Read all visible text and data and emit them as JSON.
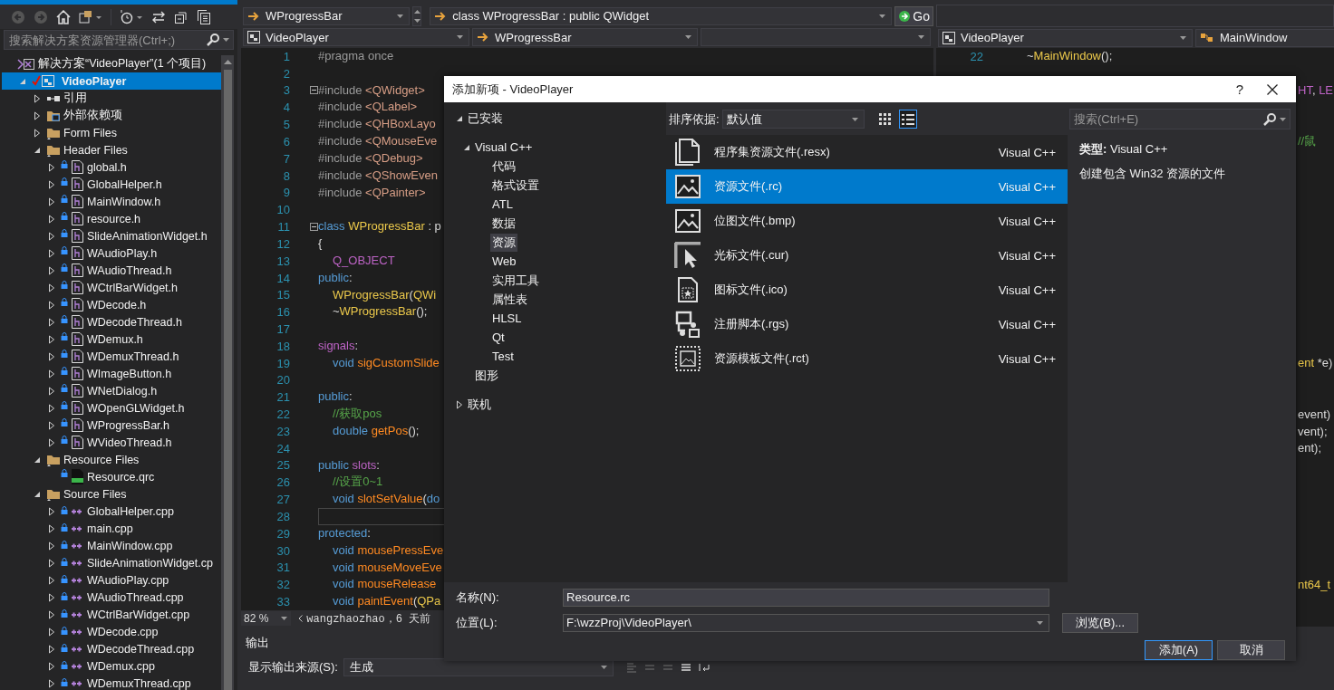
{
  "solution_explorer": {
    "search": {
      "placeholder": "搜索解决方案资源管理器(Ctrl+;)"
    },
    "tree": [
      {
        "label": "解决方案“VideoPlayer”(1 个项目)",
        "kind": "solution",
        "selected": false,
        "children": [
          {
            "label": "VideoPlayer",
            "kind": "project",
            "selected": true,
            "expanded": true,
            "children": [
              {
                "label": "引用",
                "kind": "references",
                "selected": false,
                "expanded": false
              },
              {
                "label": "外部依赖项",
                "kind": "dependencies",
                "selected": false,
                "expanded": false
              },
              {
                "label": "Form Files",
                "kind": "filter",
                "selected": false,
                "expanded": false
              },
              {
                "label": "Header Files",
                "kind": "filter",
                "selected": false,
                "expanded": true,
                "children": [
                  {
                    "label": "global.h",
                    "kind": "header",
                    "selected": false,
                    "expanded": false
                  },
                  {
                    "label": "GlobalHelper.h",
                    "kind": "header",
                    "selected": false,
                    "expanded": false
                  },
                  {
                    "label": "MainWindow.h",
                    "kind": "header",
                    "selected": false,
                    "expanded": false
                  },
                  {
                    "label": "resource.h",
                    "kind": "header",
                    "selected": false,
                    "expanded": false
                  },
                  {
                    "label": "SlideAnimationWidget.h",
                    "kind": "header",
                    "selected": false,
                    "expanded": false
                  },
                  {
                    "label": "WAudioPlay.h",
                    "kind": "header",
                    "selected": false,
                    "expanded": false
                  },
                  {
                    "label": "WAudioThread.h",
                    "kind": "header",
                    "selected": false,
                    "expanded": false
                  },
                  {
                    "label": "WCtrlBarWidget.h",
                    "kind": "header",
                    "selected": false,
                    "expanded": false
                  },
                  {
                    "label": "WDecode.h",
                    "kind": "header",
                    "selected": false,
                    "expanded": false
                  },
                  {
                    "label": "WDecodeThread.h",
                    "kind": "header",
                    "selected": false,
                    "expanded": false
                  },
                  {
                    "label": "WDemux.h",
                    "kind": "header",
                    "selected": false,
                    "expanded": false
                  },
                  {
                    "label": "WDemuxThread.h",
                    "kind": "header",
                    "selected": false,
                    "expanded": false
                  },
                  {
                    "label": "WImageButton.h",
                    "kind": "header",
                    "selected": false,
                    "expanded": false
                  },
                  {
                    "label": "WNetDialog.h",
                    "kind": "header",
                    "selected": false,
                    "expanded": false
                  },
                  {
                    "label": "WOpenGLWidget.h",
                    "kind": "header",
                    "selected": false,
                    "expanded": false
                  },
                  {
                    "label": "WProgressBar.h",
                    "kind": "header",
                    "selected": false,
                    "expanded": false
                  },
                  {
                    "label": "WVideoThread.h",
                    "kind": "header",
                    "selected": false,
                    "expanded": false
                  }
                ]
              },
              {
                "label": "Resource Files",
                "kind": "filter",
                "selected": false,
                "expanded": true,
                "children": [
                  {
                    "label": "Resource.qrc",
                    "kind": "qrc",
                    "selected": false
                  }
                ]
              },
              {
                "label": "Source Files",
                "kind": "filter",
                "selected": false,
                "expanded": true,
                "children": [
                  {
                    "label": "GlobalHelper.cpp",
                    "kind": "source",
                    "selected": false,
                    "expanded": false
                  },
                  {
                    "label": "main.cpp",
                    "kind": "source",
                    "selected": false,
                    "expanded": false
                  },
                  {
                    "label": "MainWindow.cpp",
                    "kind": "source",
                    "selected": false,
                    "expanded": false
                  },
                  {
                    "label": "SlideAnimationWidget.cp",
                    "kind": "source",
                    "selected": false,
                    "expanded": false
                  },
                  {
                    "label": "WAudioPlay.cpp",
                    "kind": "source",
                    "selected": false,
                    "expanded": false
                  },
                  {
                    "label": "WAudioThread.cpp",
                    "kind": "source",
                    "selected": false,
                    "expanded": false
                  },
                  {
                    "label": "WCtrlBarWidget.cpp",
                    "kind": "source",
                    "selected": false,
                    "expanded": false
                  },
                  {
                    "label": "WDecode.cpp",
                    "kind": "source",
                    "selected": false,
                    "expanded": false
                  },
                  {
                    "label": "WDecodeThread.cpp",
                    "kind": "source",
                    "selected": false,
                    "expanded": false
                  },
                  {
                    "label": "WDemux.cpp",
                    "kind": "source",
                    "selected": false,
                    "expanded": false
                  },
                  {
                    "label": "WDemuxThread.cpp",
                    "kind": "source",
                    "selected": false,
                    "expanded": false
                  }
                ]
              }
            ]
          }
        ]
      }
    ]
  },
  "editor": {
    "nav": {
      "scope": "WProgressBar",
      "member": "class WProgressBar : public QWidget",
      "go": "Go",
      "project": "VideoPlayer",
      "class": "WProgressBar"
    },
    "lines": [
      {
        "n": "1",
        "parts": [
          {
            "kind": "directive",
            "text": "#pragma once"
          }
        ]
      },
      {
        "n": "2"
      },
      {
        "n": "3",
        "fold": true,
        "parts": [
          {
            "kind": "directive",
            "text": "#include "
          },
          {
            "kind": "header",
            "text": "<QWidget>"
          }
        ]
      },
      {
        "n": "4",
        "parts": [
          {
            "kind": "directive",
            "text": "#include "
          },
          {
            "kind": "header",
            "text": "<QLabel>"
          }
        ]
      },
      {
        "n": "5",
        "parts": [
          {
            "kind": "directive",
            "text": "#include "
          },
          {
            "kind": "header",
            "text": "<QHBoxLayo"
          }
        ]
      },
      {
        "n": "6",
        "parts": [
          {
            "kind": "directive",
            "text": "#include "
          },
          {
            "kind": "header",
            "text": "<QMouseEve"
          }
        ]
      },
      {
        "n": "7",
        "parts": [
          {
            "kind": "directive",
            "text": "#include "
          },
          {
            "kind": "header",
            "text": "<QDebug>"
          }
        ]
      },
      {
        "n": "8",
        "parts": [
          {
            "kind": "directive",
            "text": "#include "
          },
          {
            "kind": "header",
            "text": "<QShowEven"
          }
        ]
      },
      {
        "n": "9",
        "parts": [
          {
            "kind": "directive",
            "text": "#include "
          },
          {
            "kind": "header",
            "text": "<QPainter>"
          }
        ]
      },
      {
        "n": "10"
      },
      {
        "n": "11",
        "fold": true,
        "parts": [
          {
            "kind": "keyword",
            "text": "class "
          },
          {
            "kind": "type",
            "text": "WProgressBar"
          },
          {
            "kind": "plain",
            "text": " : p"
          }
        ]
      },
      {
        "n": "12",
        "parts": [
          {
            "kind": "plain",
            "text": "{"
          }
        ]
      },
      {
        "n": "13",
        "indented": true,
        "parts": [
          {
            "kind": "macro",
            "text": "Q_OBJECT"
          }
        ]
      },
      {
        "n": "14",
        "parts": [
          {
            "kind": "keyword",
            "text": "public"
          },
          {
            "kind": "plain",
            "text": ":"
          }
        ]
      },
      {
        "n": "15",
        "indented": true,
        "parts": [
          {
            "kind": "type",
            "text": "WProgressBar"
          },
          {
            "kind": "plain",
            "text": "("
          },
          {
            "kind": "type",
            "text": "QWi"
          }
        ]
      },
      {
        "n": "16",
        "indented": true,
        "parts": [
          {
            "kind": "plain",
            "text": "~"
          },
          {
            "kind": "type",
            "text": "WProgressBar"
          },
          {
            "kind": "plain",
            "text": "();"
          }
        ]
      },
      {
        "n": "17"
      },
      {
        "n": "18",
        "parts": [
          {
            "kind": "macro",
            "text": "signals"
          },
          {
            "kind": "plain",
            "text": ":"
          }
        ]
      },
      {
        "n": "19",
        "indented": true,
        "parts": [
          {
            "kind": "keyword",
            "text": "void "
          },
          {
            "kind": "func",
            "text": "sigCustomSlide"
          }
        ]
      },
      {
        "n": "20"
      },
      {
        "n": "21",
        "parts": [
          {
            "kind": "keyword",
            "text": "public"
          },
          {
            "kind": "plain",
            "text": ":"
          }
        ]
      },
      {
        "n": "22",
        "indented": true,
        "parts": [
          {
            "kind": "comment",
            "text": "//获取pos"
          }
        ]
      },
      {
        "n": "23",
        "indented": true,
        "parts": [
          {
            "kind": "keyword",
            "text": "double "
          },
          {
            "kind": "func",
            "text": "getPos"
          },
          {
            "kind": "plain",
            "text": "();"
          }
        ]
      },
      {
        "n": "24"
      },
      {
        "n": "25",
        "parts": [
          {
            "kind": "keyword",
            "text": "public "
          },
          {
            "kind": "macro",
            "text": "slots"
          },
          {
            "kind": "plain",
            "text": ":"
          }
        ]
      },
      {
        "n": "26",
        "indented": true,
        "parts": [
          {
            "kind": "comment",
            "text": "//设置0~1"
          }
        ]
      },
      {
        "n": "27",
        "indented": true,
        "parts": [
          {
            "kind": "keyword",
            "text": "void "
          },
          {
            "kind": "func",
            "text": "slotSetValue"
          },
          {
            "kind": "plain",
            "text": "("
          },
          {
            "kind": "keyword",
            "text": "do"
          }
        ]
      },
      {
        "n": "28",
        "current": true
      },
      {
        "n": "29",
        "parts": [
          {
            "kind": "keyword",
            "text": "protected"
          },
          {
            "kind": "plain",
            "text": ":"
          }
        ]
      },
      {
        "n": "30",
        "indented": true,
        "parts": [
          {
            "kind": "keyword",
            "text": "void "
          },
          {
            "kind": "func",
            "text": "mousePressEve"
          }
        ]
      },
      {
        "n": "31",
        "indented": true,
        "parts": [
          {
            "kind": "keyword",
            "text": "void "
          },
          {
            "kind": "func",
            "text": "mouseMoveEve"
          }
        ]
      },
      {
        "n": "32",
        "indented": true,
        "parts": [
          {
            "kind": "keyword",
            "text": "void "
          },
          {
            "kind": "func",
            "text": "mouseRelease"
          }
        ]
      },
      {
        "n": "33",
        "indented": true,
        "parts": [
          {
            "kind": "keyword",
            "text": "void "
          },
          {
            "kind": "func",
            "text": "paintEvent"
          },
          {
            "kind": "plain",
            "text": "("
          },
          {
            "kind": "type",
            "text": "QPa"
          }
        ]
      }
    ],
    "zoom": "82 %",
    "blame": "wangzhaozhao，6 天前"
  },
  "side_editor": {
    "project": "VideoPlayer",
    "class": "MainWindow",
    "lines": [
      {
        "n": "22",
        "indented": true,
        "parts": [
          {
            "kind": "plain",
            "text": "~"
          },
          {
            "kind": "type",
            "text": "MainWindow"
          },
          {
            "kind": "plain",
            "text": "();"
          }
        ]
      }
    ],
    "edge_fragments": [
      {
        "parts": [
          {
            "kind": "macro",
            "text": "HT"
          },
          {
            "kind": "plain",
            "text": ", "
          },
          {
            "kind": "macro",
            "text": "LE"
          }
        ]
      },
      {
        "parts": [
          {
            "kind": "comment",
            "text": "//鼠"
          }
        ]
      },
      {
        "parts": [
          {
            "kind": "type",
            "text": "ent"
          },
          {
            "kind": "plain",
            "text": " *e)"
          }
        ]
      },
      {
        "parts": [
          {
            "kind": "plain",
            "text": "event)"
          }
        ]
      },
      {
        "parts": [
          {
            "kind": "plain",
            "text": "vent);"
          }
        ]
      },
      {
        "parts": [
          {
            "kind": "plain",
            "text": "ent);"
          }
        ]
      },
      {
        "parts": [
          {
            "kind": "type",
            "text": "nt64_t"
          }
        ]
      }
    ]
  },
  "output": {
    "title": "输出",
    "source_label": "显示输出来源(S):",
    "source": "生成"
  },
  "dialog": {
    "title": "添加新项 - VideoPlayer",
    "help": "?",
    "categories": [
      {
        "label": "已安装",
        "selected": false,
        "expanded": true,
        "children": [
          {
            "label": "Visual C++",
            "selected": false,
            "expanded": true,
            "children": [
              {
                "label": "代码",
                "selected": false
              },
              {
                "label": "格式设置",
                "selected": false
              },
              {
                "label": "ATL",
                "selected": false
              },
              {
                "label": "数据",
                "selected": false
              },
              {
                "label": "资源",
                "selected": true
              },
              {
                "label": "Web",
                "selected": false
              },
              {
                "label": "实用工具",
                "selected": false
              },
              {
                "label": "属性表",
                "selected": false
              },
              {
                "label": "HLSL",
                "selected": false
              },
              {
                "label": "Qt",
                "selected": false
              },
              {
                "label": "Test",
                "selected": false
              }
            ]
          },
          {
            "label": "图形",
            "selected": false
          }
        ]
      },
      {
        "label": "联机",
        "selected": false,
        "expanded": false
      }
    ],
    "sort_label": "排序依据:",
    "sort": "默认值",
    "views": [
      {
        "kind": "grid",
        "selected": false
      },
      {
        "kind": "list",
        "selected": true
      }
    ],
    "templates": [
      {
        "kind": "resx",
        "name": "程序集资源文件(.resx)",
        "type": "Visual C++",
        "selected": false
      },
      {
        "kind": "image",
        "name": "资源文件(.rc)",
        "type": "Visual C++",
        "selected": true
      },
      {
        "kind": "image",
        "name": "位图文件(.bmp)",
        "type": "Visual C++",
        "selected": false
      },
      {
        "kind": "cursor",
        "name": "光标文件(.cur)",
        "type": "Visual C++",
        "selected": false
      },
      {
        "kind": "icon",
        "name": "图标文件(.ico)",
        "type": "Visual C++",
        "selected": false
      },
      {
        "kind": "script",
        "name": "注册脚本(.rgs)",
        "type": "Visual C++",
        "selected": false
      },
      {
        "kind": "template",
        "name": "资源模板文件(.rct)",
        "type": "Visual C++",
        "selected": false
      }
    ],
    "search": {
      "placeholder": "搜索(Ctrl+E)"
    },
    "info": {
      "type_line": "**类型:**  Visual C++",
      "description": "创建包含 Win32 资源的文件"
    },
    "name_label": "名称(N):",
    "name": "Resource.rc",
    "location_label": "位置(L):",
    "location": "F:\\wzzProj\\VideoPlayer\\",
    "browse": "浏览(B)...",
    "add": "添加(A)",
    "cancel": "取消"
  }
}
